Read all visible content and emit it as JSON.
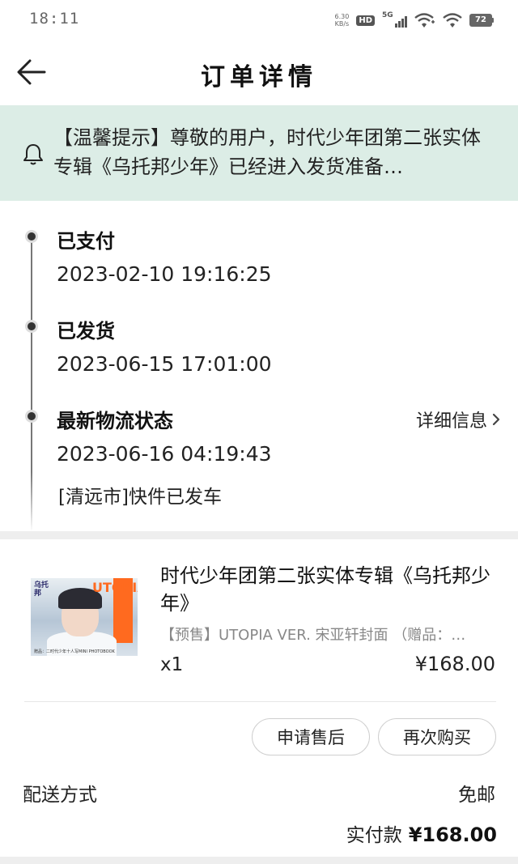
{
  "status_bar": {
    "time": "18:11",
    "net_speed_value": "6.30",
    "net_speed_unit": "KB/s",
    "hd": "HD",
    "network": "5G",
    "battery": "72",
    "icons": [
      "hd-icon",
      "signal-5g-icon",
      "wifi-calling-icon",
      "wifi-icon",
      "battery-icon"
    ]
  },
  "header": {
    "title": "订单详情",
    "back_icon": "back-arrow-icon"
  },
  "notice": {
    "icon": "bell-icon",
    "text": "【温馨提示】尊敬的用户，时代少年团第二张实体专辑《乌托邦少年》已经进入发货准备…",
    "background": "#dcede6"
  },
  "timeline": {
    "items": [
      {
        "title": "已支付",
        "time": "2023-02-10 19:16:25"
      },
      {
        "title": "已发货",
        "time": "2023-06-15 17:01:00"
      },
      {
        "title": "最新物流状态",
        "time": "2023-06-16 04:19:43",
        "desc": "[清远市]快件已发车"
      }
    ],
    "detail_link": "详细信息"
  },
  "product": {
    "image_brand": "UTOPIA",
    "image_title": "乌托邦",
    "image_caption": "赠品：二时代少年十人写MINI PHOTOBOOK",
    "name": "时代少年团第二张实体专辑《乌托邦少年》",
    "spec": "【预售】UTOPIA VER. 宋亚轩封面 （赠品：…",
    "qty": "x1",
    "price": "¥168.00",
    "accent": "#ff6a1f"
  },
  "actions": {
    "after_sale": "申请售后",
    "rebuy": "再次购买"
  },
  "summary": {
    "shipping_label": "配送方式",
    "shipping_value": "免邮",
    "paid_label": "实付款",
    "paid_amount": "¥168.00"
  }
}
